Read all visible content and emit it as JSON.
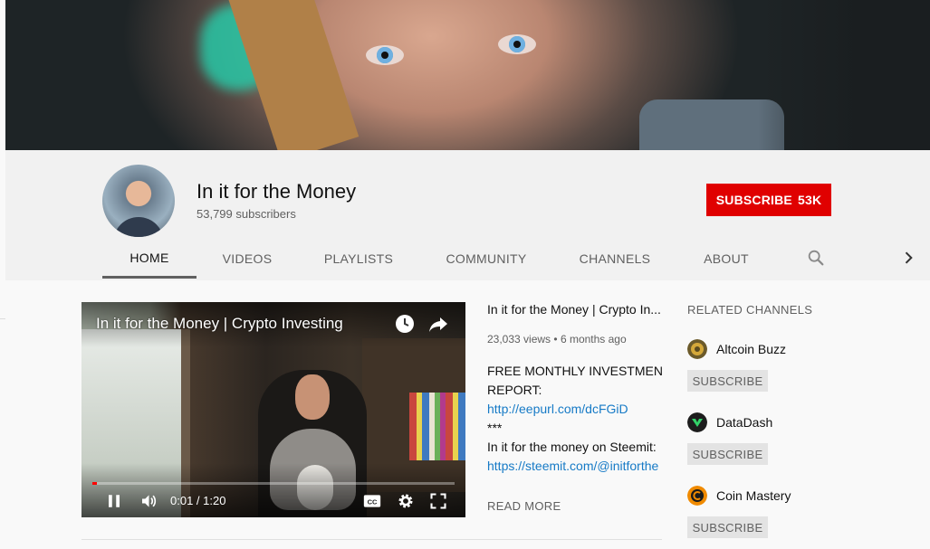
{
  "channel": {
    "name": "In it for the Money",
    "subscribers": "53,799 subscribers",
    "subscribe_label": "SUBSCRIBE",
    "subscribe_count": "53K"
  },
  "tabs": [
    {
      "label": "HOME",
      "active": true
    },
    {
      "label": "VIDEOS"
    },
    {
      "label": "PLAYLISTS"
    },
    {
      "label": "COMMUNITY"
    },
    {
      "label": "CHANNELS"
    },
    {
      "label": "ABOUT"
    }
  ],
  "icons": {
    "search": "search-icon",
    "next": "chevron-right-icon"
  },
  "player": {
    "title": "In it for the Money | Crypto Investing",
    "time": "0:01 / 1:20",
    "progress": 0.0125,
    "icons": [
      "watch-later-icon",
      "share-icon",
      "pause-icon",
      "volume-icon",
      "captions-icon",
      "settings-icon",
      "fullscreen-icon"
    ]
  },
  "video": {
    "title": "In it for the Money | Crypto In...",
    "views": "23,033 views",
    "age": "6 months ago",
    "separator": "•",
    "desc": [
      "FREE MONTHLY INVESTMENT",
      "REPORT:",
      "http://eepurl.com/dcFGiD",
      "***",
      "In it for the money on Steemit:",
      "https://steemit.com/@initforthe"
    ],
    "read_more": "READ MORE"
  },
  "related": {
    "heading": "RELATED CHANNELS",
    "channels": [
      {
        "name": "Altcoin Buzz",
        "subscribe": "SUBSCRIBE",
        "color": "#6b5a2a"
      },
      {
        "name": "DataDash",
        "subscribe": "SUBSCRIBE",
        "color": "#1d1d1d"
      },
      {
        "name": "Coin Mastery",
        "subscribe": "SUBSCRIBE",
        "color": "#f08a00"
      }
    ]
  },
  "colors": {
    "accent": "#e00000",
    "link": "#167ac6"
  }
}
